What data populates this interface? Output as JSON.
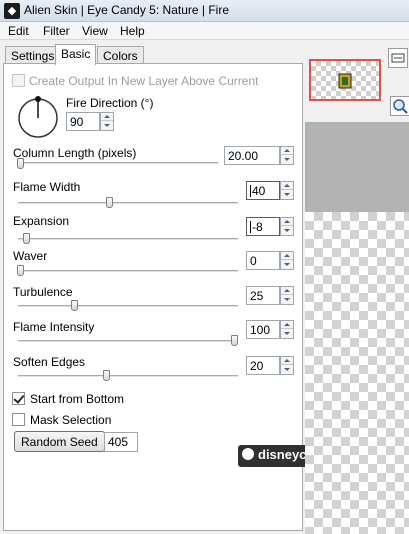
{
  "window": {
    "title": "Alien Skin | Eye Candy 5: Nature | Fire",
    "app_icon_glyph": "◆"
  },
  "menu": [
    "Edit",
    "Filter",
    "View",
    "Help"
  ],
  "tabs": [
    {
      "label": "Settings",
      "active": false
    },
    {
      "label": "Basic",
      "active": true
    },
    {
      "label": "Colors",
      "active": false
    }
  ],
  "create_output": {
    "label": "Create Output In New Layer Above Current",
    "checked": false,
    "enabled": false
  },
  "fire_direction": {
    "label": "Fire Direction (°)",
    "value": "90",
    "angle_deg": 90
  },
  "sliders": [
    {
      "label": "Column Length (pixels)",
      "value": "20.00",
      "fraction": 0.0
    },
    {
      "label": "Flame Width",
      "value": "40",
      "fraction": 0.41
    },
    {
      "label": "Expansion",
      "value": "-8",
      "fraction": 0.03
    },
    {
      "label": "Waver",
      "value": "0",
      "fraction": 0.0
    },
    {
      "label": "Turbulence",
      "value": "25",
      "fraction": 0.25
    },
    {
      "label": "Flame Intensity",
      "value": "100",
      "fraction": 1.0
    },
    {
      "label": "Soften Edges",
      "value": "20",
      "fraction": 0.4
    }
  ],
  "start_from_bottom": {
    "label": "Start from Bottom",
    "checked": true
  },
  "mask_selection": {
    "label": "Mask Selection",
    "checked": false
  },
  "random_seed": {
    "button_label": "Random Seed",
    "value": "405"
  },
  "watermark": {
    "text": "disneycenter.com"
  },
  "icons": [
    "app-icon",
    "dial-icon",
    "preview-thumbnail",
    "navigator-icon",
    "zoom-icon"
  ],
  "colors": {
    "accent_frame": "#e05050",
    "checker_light": "#ffffff",
    "checker_dark": "#d2d2d2"
  }
}
